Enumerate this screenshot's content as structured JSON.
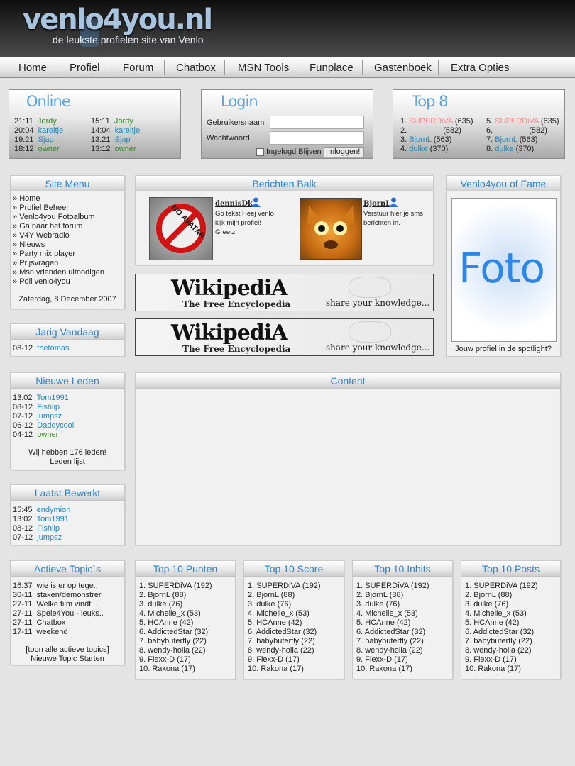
{
  "header": {
    "logo_title": "venlo4you.nl",
    "logo_subtitle": "de leukste    profielen site van Venlo"
  },
  "nav": [
    "Home",
    "Profiel",
    "Forum",
    "Chatbox",
    "MSN Tools",
    "Funplace",
    "Gastenboek",
    "Extra Opties"
  ],
  "online": {
    "title": "Online",
    "col1": [
      {
        "time": "21:11",
        "name": "Jordy",
        "color": "green"
      },
      {
        "time": "20:04",
        "name": "kareltje",
        "color": "blue"
      },
      {
        "time": "19:21",
        "name": "Sjap",
        "color": "blue"
      },
      {
        "time": "18:12",
        "name": "owner",
        "color": "green"
      }
    ],
    "col2": [
      {
        "time": "15:11",
        "name": "Jordy",
        "color": "green"
      },
      {
        "time": "14:04",
        "name": "kareltje",
        "color": "blue"
      },
      {
        "time": "13:21",
        "name": "Sjap",
        "color": "blue"
      },
      {
        "time": "13:12",
        "name": "owner",
        "color": "green"
      }
    ]
  },
  "login": {
    "title": "Login",
    "username_label": "Gebruikersnaam",
    "password_label": "Wachtwoord",
    "remember_label": "Ingelogd Blijven",
    "submit_label": "Inloggen!"
  },
  "top8": {
    "title": "Top 8",
    "col1": [
      {
        "rank": "1.",
        "name": "SUPERDiVA",
        "score": "(635)",
        "color": "pink"
      },
      {
        "rank": "2.",
        "name": "",
        "score": "(582)",
        "color": "pink"
      },
      {
        "rank": "3.",
        "name": "BjornL",
        "score": "(563)",
        "color": "blue"
      },
      {
        "rank": "4.",
        "name": "dulke",
        "score": "(370)",
        "color": "blue"
      }
    ],
    "col2": [
      {
        "rank": "5.",
        "name": "SUPERDiVA",
        "score": "(635)",
        "color": "pink"
      },
      {
        "rank": "6.",
        "name": "",
        "score": "(582)",
        "color": "pink"
      },
      {
        "rank": "7.",
        "name": "BjornL",
        "score": "(563)",
        "color": "blue"
      },
      {
        "rank": "8.",
        "name": "dulke",
        "score": "(370)",
        "color": "blue"
      }
    ]
  },
  "site_menu": {
    "title": "Site Menu",
    "items": [
      "Home",
      "Profiel Beheer",
      "Venlo4you Fotoalbum",
      "Ga naar het forum",
      "V4Y Webradio",
      "Nieuws",
      "Party mix player",
      "Prijsvragen",
      "Msn vrienden uitnodigen",
      "Poll venlo4you"
    ],
    "date": "Zaterdag, 8 December 2007"
  },
  "jarig": {
    "title": "Jarig Vandaag",
    "items": [
      {
        "date": "08-12",
        "name": "thetomas"
      }
    ]
  },
  "nieuwe_leden": {
    "title": "Nieuwe Leden",
    "items": [
      {
        "time": "13:02",
        "name": "Tom1991",
        "color": "blue"
      },
      {
        "time": "08-12",
        "name": "Fishlip",
        "color": "blue"
      },
      {
        "time": "07-12",
        "name": "jumpsz",
        "color": "blue"
      },
      {
        "time": "06-12",
        "name": "Daddycool",
        "color": "blue"
      },
      {
        "time": "04-12",
        "name": "owner",
        "color": "green"
      }
    ],
    "count_text": "Wij hebben 176 leden!",
    "list_link": "Leden lijst"
  },
  "laatst_bewerkt": {
    "title": "Laatst Bewerkt",
    "items": [
      {
        "time": "15:45",
        "name": "endymion"
      },
      {
        "time": "13:02",
        "name": "Tom1991"
      },
      {
        "time": "08-12",
        "name": "Fishlip"
      },
      {
        "time": "07-12",
        "name": "jumpsz"
      }
    ]
  },
  "berichten": {
    "title": "Berichten Balk",
    "messages": [
      {
        "user": "dennisDk",
        "text": "Go tekst Heej venlo kijk mijn profiel! Greetz",
        "avatar_text": "NO AVATAR"
      },
      {
        "user": "BjornL",
        "text": "Verstuur hier je sms berichten in."
      }
    ]
  },
  "wiki_banner": {
    "title": "WikipediA",
    "subtitle": "The Free Encyclopedia",
    "tagline": "share your knowledge..."
  },
  "fame": {
    "title": "Venlo4you of Fame",
    "photo_text": "Foto",
    "caption": "Jouw profiel in de spotlight?"
  },
  "content": {
    "title": "Content"
  },
  "actieve_topics": {
    "title": "Actieve Topic`s",
    "items": [
      {
        "date": "16:37",
        "title": "wie is er op tege.."
      },
      {
        "date": "30-11",
        "title": "staken/demonstrer.."
      },
      {
        "date": "27-11",
        "title": "Welke film vindt .."
      },
      {
        "date": "27-11",
        "title": "Spele4You - leuks.."
      },
      {
        "date": "27-11",
        "title": "Chatbox"
      },
      {
        "date": "17-11",
        "title": "weekend"
      }
    ],
    "all_link": "[toon alle actieve topics]",
    "new_link": "Nieuwe Topic Starten"
  },
  "top_lists": [
    {
      "title": "Top 10 Punten"
    },
    {
      "title": "Top 10 Score"
    },
    {
      "title": "Top 10 Inhits"
    },
    {
      "title": "Top 10 Posts"
    }
  ],
  "top10_entries": [
    "1. SUPERDiVA (192)",
    "2. BjornL (88)",
    "3. dulke (76)",
    "4. Michelle_x (53)",
    "5. HCAnne (42)",
    "6. AddictedStar (32)",
    "7. babybuterfly (22)",
    "8. wendy-holla (22)",
    "9. Flexx-D (17)",
    "10. Rakona (17)"
  ]
}
